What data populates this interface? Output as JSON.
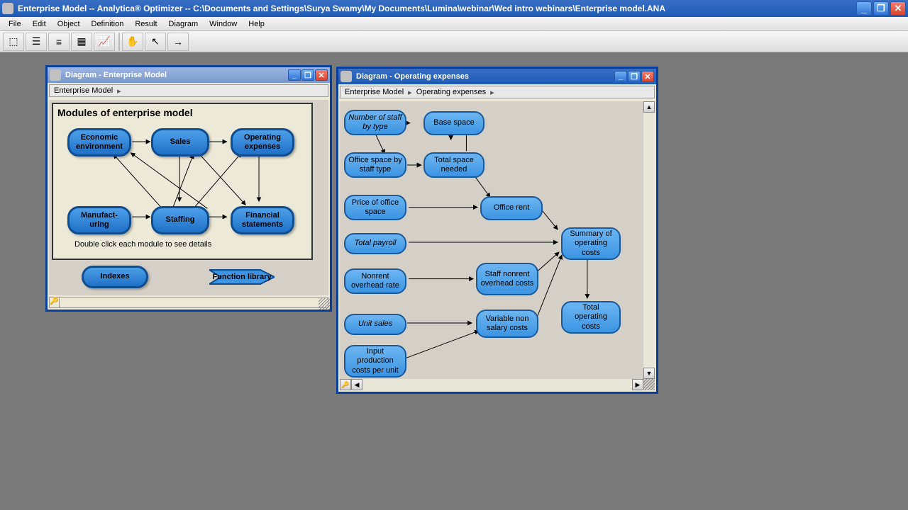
{
  "app": {
    "title": "Enterprise Model -- Analytica® Optimizer -- C:\\Documents and Settings\\Surya Swamy\\My Documents\\Lumina\\webinar\\Wed intro webinars\\Enterprise model.ANA"
  },
  "menu": {
    "file": "File",
    "edit": "Edit",
    "object": "Object",
    "definition": "Definition",
    "result": "Result",
    "diagram": "Diagram",
    "window": "Window",
    "help": "Help"
  },
  "win1": {
    "title": "Diagram - Enterprise Model",
    "breadcrumb": "Enterprise Model",
    "frame_title": "Modules of enterprise model",
    "nodes": {
      "econ": "Economic environment",
      "sales": "Sales",
      "opex": "Operating expenses",
      "mfg": "Manufact-uring",
      "staffing": "Staffing",
      "fin": "Financial statements",
      "indexes": "Indexes",
      "funclib": "Function library"
    },
    "caption": "Double click each module to see details",
    "status_key": "🔑"
  },
  "win2": {
    "title": "Diagram - Operating expenses",
    "breadcrumb1": "Enterprise Model",
    "breadcrumb2": "Operating expenses",
    "nodes": {
      "num_staff": "Number of staff by type",
      "base_space": "Base space",
      "office_space_staff": "Office space by staff type",
      "total_space": "Total space needed",
      "price_office": "Price of office space",
      "office_rent": "Office rent",
      "total_payroll": "Total payroll",
      "nonrent_rate": "Nonrent overhead rate",
      "staff_nonrent": "Staff nonrent overhead costs",
      "summary": "Summary of operating costs",
      "unit_sales": "Unit sales",
      "var_nonsalary": "Variable non salary costs",
      "input_prod": "Input production costs per unit",
      "total_op": "Total operating costs"
    }
  }
}
